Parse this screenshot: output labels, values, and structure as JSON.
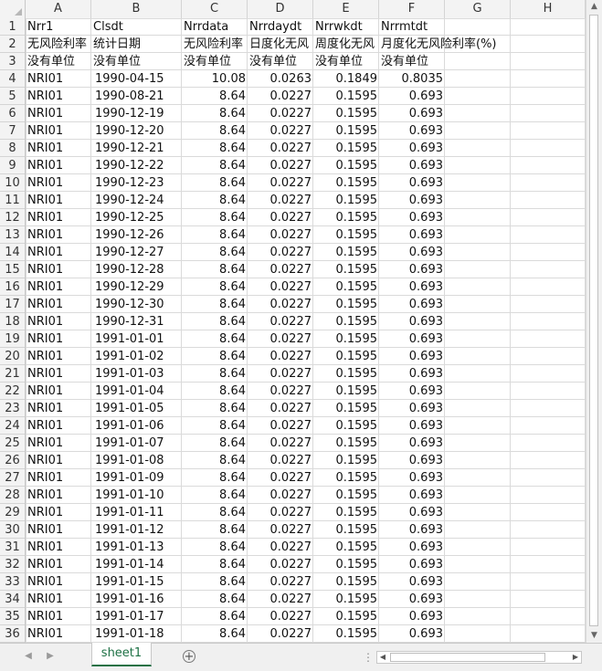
{
  "columns": [
    "A",
    "B",
    "C",
    "D",
    "E",
    "F",
    "G",
    "H"
  ],
  "rows": [
    [
      "Nrr1",
      "Clsdt",
      "Nrrdata",
      "Nrrdaydt",
      "Nrrwkdt",
      "Nrrmtdt"
    ],
    [
      "无风险利率",
      "统计日期",
      "无风险利率",
      "日度化无风",
      "周度化无风",
      "月度化无风险利率(%)"
    ],
    [
      "没有单位",
      "没有单位",
      "没有单位",
      "没有单位",
      "没有单位",
      "没有单位"
    ],
    [
      "NRI01",
      "1990-04-15",
      "10.08",
      "0.0263",
      "0.1849",
      "0.8035"
    ],
    [
      "NRI01",
      "1990-08-21",
      "8.64",
      "0.0227",
      "0.1595",
      "0.693"
    ],
    [
      "NRI01",
      "1990-12-19",
      "8.64",
      "0.0227",
      "0.1595",
      "0.693"
    ],
    [
      "NRI01",
      "1990-12-20",
      "8.64",
      "0.0227",
      "0.1595",
      "0.693"
    ],
    [
      "NRI01",
      "1990-12-21",
      "8.64",
      "0.0227",
      "0.1595",
      "0.693"
    ],
    [
      "NRI01",
      "1990-12-22",
      "8.64",
      "0.0227",
      "0.1595",
      "0.693"
    ],
    [
      "NRI01",
      "1990-12-23",
      "8.64",
      "0.0227",
      "0.1595",
      "0.693"
    ],
    [
      "NRI01",
      "1990-12-24",
      "8.64",
      "0.0227",
      "0.1595",
      "0.693"
    ],
    [
      "NRI01",
      "1990-12-25",
      "8.64",
      "0.0227",
      "0.1595",
      "0.693"
    ],
    [
      "NRI01",
      "1990-12-26",
      "8.64",
      "0.0227",
      "0.1595",
      "0.693"
    ],
    [
      "NRI01",
      "1990-12-27",
      "8.64",
      "0.0227",
      "0.1595",
      "0.693"
    ],
    [
      "NRI01",
      "1990-12-28",
      "8.64",
      "0.0227",
      "0.1595",
      "0.693"
    ],
    [
      "NRI01",
      "1990-12-29",
      "8.64",
      "0.0227",
      "0.1595",
      "0.693"
    ],
    [
      "NRI01",
      "1990-12-30",
      "8.64",
      "0.0227",
      "0.1595",
      "0.693"
    ],
    [
      "NRI01",
      "1990-12-31",
      "8.64",
      "0.0227",
      "0.1595",
      "0.693"
    ],
    [
      "NRI01",
      "1991-01-01",
      "8.64",
      "0.0227",
      "0.1595",
      "0.693"
    ],
    [
      "NRI01",
      "1991-01-02",
      "8.64",
      "0.0227",
      "0.1595",
      "0.693"
    ],
    [
      "NRI01",
      "1991-01-03",
      "8.64",
      "0.0227",
      "0.1595",
      "0.693"
    ],
    [
      "NRI01",
      "1991-01-04",
      "8.64",
      "0.0227",
      "0.1595",
      "0.693"
    ],
    [
      "NRI01",
      "1991-01-05",
      "8.64",
      "0.0227",
      "0.1595",
      "0.693"
    ],
    [
      "NRI01",
      "1991-01-06",
      "8.64",
      "0.0227",
      "0.1595",
      "0.693"
    ],
    [
      "NRI01",
      "1991-01-07",
      "8.64",
      "0.0227",
      "0.1595",
      "0.693"
    ],
    [
      "NRI01",
      "1991-01-08",
      "8.64",
      "0.0227",
      "0.1595",
      "0.693"
    ],
    [
      "NRI01",
      "1991-01-09",
      "8.64",
      "0.0227",
      "0.1595",
      "0.693"
    ],
    [
      "NRI01",
      "1991-01-10",
      "8.64",
      "0.0227",
      "0.1595",
      "0.693"
    ],
    [
      "NRI01",
      "1991-01-11",
      "8.64",
      "0.0227",
      "0.1595",
      "0.693"
    ],
    [
      "NRI01",
      "1991-01-12",
      "8.64",
      "0.0227",
      "0.1595",
      "0.693"
    ],
    [
      "NRI01",
      "1991-01-13",
      "8.64",
      "0.0227",
      "0.1595",
      "0.693"
    ],
    [
      "NRI01",
      "1991-01-14",
      "8.64",
      "0.0227",
      "0.1595",
      "0.693"
    ],
    [
      "NRI01",
      "1991-01-15",
      "8.64",
      "0.0227",
      "0.1595",
      "0.693"
    ],
    [
      "NRI01",
      "1991-01-16",
      "8.64",
      "0.0227",
      "0.1595",
      "0.693"
    ],
    [
      "NRI01",
      "1991-01-17",
      "8.64",
      "0.0227",
      "0.1595",
      "0.693"
    ],
    [
      "NRI01",
      "1991-01-18",
      "8.64",
      "0.0227",
      "0.1595",
      "0.693"
    ]
  ],
  "sheet_tab": "sheet1",
  "icons": {
    "add_sheet": "plus-circle-icon",
    "nav_prev": "triangle-left-icon",
    "nav_next": "triangle-right-icon"
  },
  "colors": {
    "tab_active": "#1e7145",
    "header_bg": "#f3f3f3",
    "grid_line": "#dadada"
  }
}
